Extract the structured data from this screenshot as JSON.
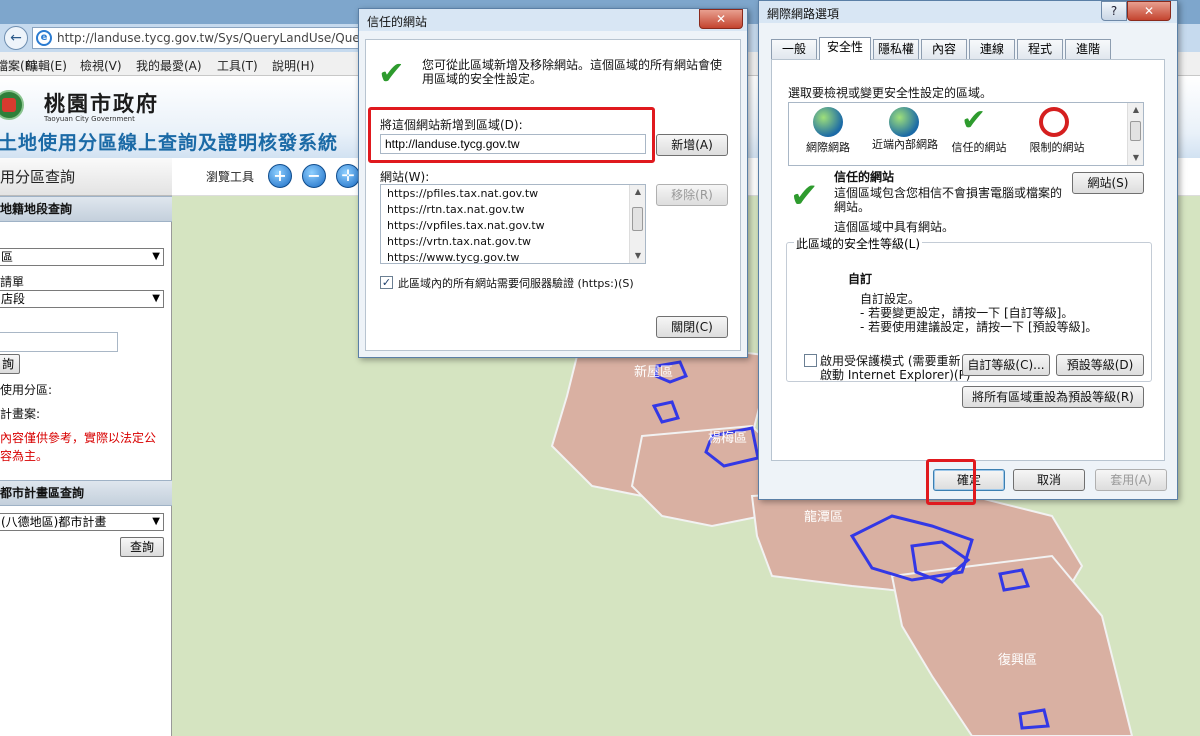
{
  "browser": {
    "url": "http://landuse.tycg.gov.tw/Sys/QueryLandUse/Query",
    "menu": [
      "檔案(F)",
      "編輯(E)",
      "檢視(V)",
      "我的最愛(A)",
      "工具(T)",
      "說明(H)"
    ]
  },
  "site": {
    "city_name": "桃園市政府",
    "city_en": "Taoyuan City Government",
    "system_title": "土地使用分區線上查詢及證明核發系統"
  },
  "left_panel": {
    "title": "用分區查詢",
    "section1": "地籍地段查詢",
    "district_value": "區",
    "section_label": "請單",
    "section_value": "店段",
    "query_button": "詢",
    "zone_label": "使用分區:",
    "plan_label": "計畫案:",
    "note_line1": "內容僅供參考，實際以法定公",
    "note_line2": "容為主。",
    "section2": "都市計畫區查詢",
    "plan_value": "(八德地區)都市計畫",
    "plan_query_button": "查詢"
  },
  "map": {
    "toolbar_label": "瀏覽工具",
    "labels": [
      "新屋區",
      "楊梅區",
      "龍潭區",
      "復興區"
    ]
  },
  "trusted_dialog": {
    "title": "信任的網站",
    "close_label": "✕",
    "description_line1": "您可從此區域新增及移除網站。這個區域的所有網站會使",
    "description_line2": "用區域的安全性設定。",
    "add_label": "將這個網站新增到區域(D):",
    "add_value": "http://landuse.tycg.gov.tw",
    "add_button": "新增(A)",
    "websites_label": "網站(W):",
    "websites": [
      "https://pfiles.tax.nat.gov.tw",
      "https://rtn.tax.nat.gov.tw",
      "https://vpfiles.tax.nat.gov.tw",
      "https://vrtn.tax.nat.gov.tw",
      "https://www.tycg.gov.tw"
    ],
    "remove_button": "移除(R)",
    "https_check": "此區域內的所有網站需要伺服器驗證 (https:)(S)",
    "close_button": "關閉(C)"
  },
  "options_dialog": {
    "title": "網際網路選項",
    "help_label": "?",
    "close_label": "✕",
    "tabs": [
      "一般",
      "安全性",
      "隱私權",
      "內容",
      "連線",
      "程式",
      "進階"
    ],
    "zone_prompt": "選取要檢視或變更安全性設定的區域。",
    "zones": [
      "網際網路",
      "近端內部網路",
      "信任的網站",
      "限制的網站"
    ],
    "zone_title": "信任的網站",
    "zone_desc_line1": "這個區域包含您相信不會損害電腦或檔案的",
    "zone_desc_line2": "網站。",
    "zone_desc_line3": "這個區域中具有網站。",
    "sites_button": "網站(S)",
    "level_group": "此區域的安全性等級(L)",
    "level_title": "自訂",
    "level_line1": "自訂設定。",
    "level_line2": "- 若要變更設定，請按一下 [自訂等級]。",
    "level_line3": "- 若要使用建議設定，請按一下 [預設等級]。",
    "protected_mode_line1": "啟用受保護模式 (需要重新",
    "protected_mode_line2": "啟動 Internet Explorer)(P)",
    "custom_level_button": "自訂等級(C)...",
    "default_level_button": "預設等級(D)",
    "reset_all_button": "將所有區域重設為預設等級(R)",
    "ok_button": "確定",
    "cancel_button": "取消",
    "apply_button": "套用(A)"
  },
  "colors": {
    "highlight": "#e0191e",
    "link_blue": "#1b6aa6",
    "map_land": "#d5e4c1",
    "map_district": "#d9b0a2",
    "boundary": "#3338e6"
  }
}
